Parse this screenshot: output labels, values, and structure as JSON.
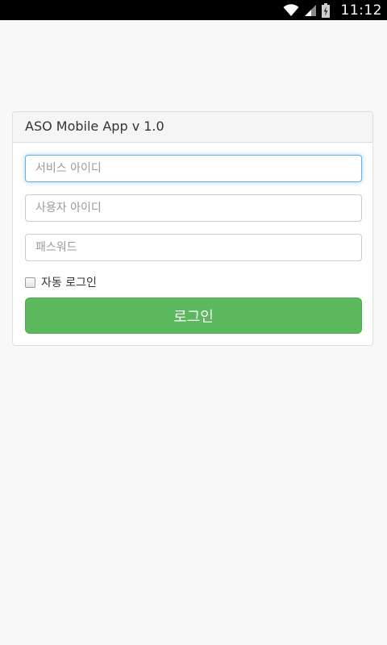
{
  "status_bar": {
    "time": "11:12",
    "icons": [
      "wifi-icon",
      "signal-icon",
      "battery-icon"
    ]
  },
  "panel": {
    "title": "ASO Mobile App v 1.0"
  },
  "form": {
    "service_id_placeholder": "서비스 아이디",
    "user_id_placeholder": "사용자 아이디",
    "password_placeholder": "패스워드",
    "auto_login_label": "자동 로그인",
    "auto_login_checked": false,
    "login_button_label": "로그인"
  },
  "colors": {
    "login_button": "#5cb85c",
    "focus_border": "#66afe9",
    "background": "#f8f8f8"
  }
}
